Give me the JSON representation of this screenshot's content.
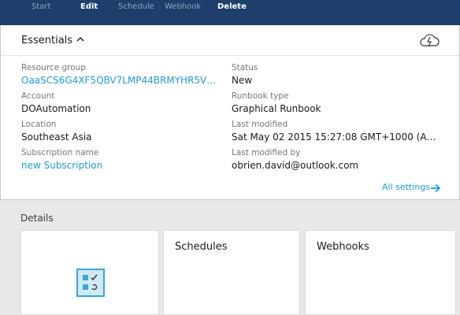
{
  "toolbar": {
    "start": "Start",
    "edit": "Edit",
    "schedule": "Schedule",
    "webhook": "Webhook",
    "delete": "Delete"
  },
  "essentials": {
    "title": "Essentials",
    "left": [
      {
        "label": "Resource group",
        "value": "OaaSCS6G4XF5QBV7LMP44BRMYHR5VW6..."
      },
      {
        "label": "Account",
        "value": "DOAutomation"
      },
      {
        "label": "Location",
        "value": "Southeast Asia"
      },
      {
        "label": "Subscription name",
        "value": "new Subscription"
      }
    ],
    "right": [
      {
        "label": "Status",
        "value": "New"
      },
      {
        "label": "Runbook type",
        "value": "Graphical Runbook"
      },
      {
        "label": "Last modified",
        "value": "Sat May 02 2015 15:27:08 GMT+1000 (AES..."
      },
      {
        "label": "Last modified by",
        "value": "obrien.david@outlook.com"
      }
    ],
    "all_settings": "All settings"
  },
  "details": {
    "title": "Details",
    "tiles": [
      "Schedules",
      "Webhooks"
    ]
  },
  "icons": {
    "collapse": "chevron-up-icon",
    "cloud": "cloud-lightning-icon",
    "arrow": "arrow-right-icon",
    "runbook": "runbook-checklist-icon"
  },
  "colors": {
    "toolbar_bg": "#1f3e6b",
    "link": "#1f9bd6",
    "panel_bg": "#e8e8e8"
  }
}
